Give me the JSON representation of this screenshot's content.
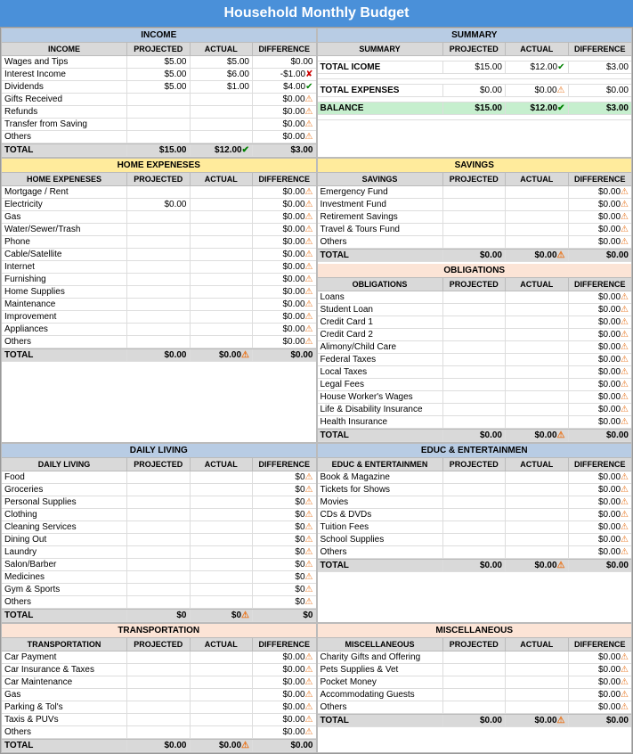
{
  "title": "Household Monthly Budget",
  "income": {
    "header": "INCOME",
    "cols": [
      "INCOME",
      "PROJECTED",
      "ACTUAL",
      "DIFFERENCE"
    ],
    "rows": [
      {
        "label": "Wages and Tips",
        "projected": "$5.00",
        "actual": "$5.00",
        "diff": "$0.00",
        "icon": ""
      },
      {
        "label": "Interest Income",
        "projected": "$5.00",
        "actual": "$6.00",
        "diff": "-$1.00",
        "icon": "red"
      },
      {
        "label": "Dividends",
        "projected": "$5.00",
        "actual": "$1.00",
        "diff": "$4.00",
        "icon": "green"
      },
      {
        "label": "Gifts Received",
        "projected": "",
        "actual": "",
        "diff": "$0.00",
        "icon": "orange"
      },
      {
        "label": "Refunds",
        "projected": "",
        "actual": "",
        "diff": "$0.00",
        "icon": "orange"
      },
      {
        "label": "Transfer from Saving",
        "projected": "",
        "actual": "",
        "diff": "$0.00",
        "icon": "orange"
      },
      {
        "label": "Others",
        "projected": "",
        "actual": "",
        "diff": "$0.00",
        "icon": "orange"
      }
    ],
    "total": {
      "label": "TOTAL",
      "projected": "$15.00",
      "actual": "$12.00",
      "diff": "$3.00",
      "icon": "green"
    }
  },
  "summary": {
    "header": "SUMMARY",
    "rows": [
      {
        "label": "TOTAL ICOME",
        "projected": "$15.00",
        "actual": "$12.00",
        "diff": "$3.00",
        "icon": "green"
      },
      {
        "label": "TOTAL EXPENSES",
        "projected": "$0.00",
        "actual": "$0.00",
        "diff": "$0.00",
        "icon": "orange"
      },
      {
        "label": "BALANCE",
        "projected": "$15.00",
        "actual": "$12.00",
        "diff": "$3.00",
        "icon": "green"
      }
    ]
  },
  "home_expenses": {
    "header": "HOME EXPENESES",
    "rows": [
      {
        "label": "Mortgage / Rent",
        "projected": "",
        "actual": "",
        "diff": "$0.00",
        "icon": "orange"
      },
      {
        "label": "Electricity",
        "projected": "$0.00",
        "actual": "",
        "diff": "$0.00",
        "icon": "orange"
      },
      {
        "label": "Gas",
        "projected": "",
        "actual": "",
        "diff": "$0.00",
        "icon": "orange"
      },
      {
        "label": "Water/Sewer/Trash",
        "projected": "",
        "actual": "",
        "diff": "$0.00",
        "icon": "orange"
      },
      {
        "label": "Phone",
        "projected": "",
        "actual": "",
        "diff": "$0.00",
        "icon": "orange"
      },
      {
        "label": "Cable/Satellite",
        "projected": "",
        "actual": "",
        "diff": "$0.00",
        "icon": "orange"
      },
      {
        "label": "Internet",
        "projected": "",
        "actual": "",
        "diff": "$0.00",
        "icon": "orange"
      },
      {
        "label": "Furnishing",
        "projected": "",
        "actual": "",
        "diff": "$0.00",
        "icon": "orange"
      },
      {
        "label": "Home Supplies",
        "projected": "",
        "actual": "",
        "diff": "$0.00",
        "icon": "orange"
      },
      {
        "label": "Maintenance",
        "projected": "",
        "actual": "",
        "diff": "$0.00",
        "icon": "orange"
      },
      {
        "label": "Improvement",
        "projected": "",
        "actual": "",
        "diff": "$0.00",
        "icon": "orange"
      },
      {
        "label": "Appliances",
        "projected": "",
        "actual": "",
        "diff": "$0.00",
        "icon": "orange"
      },
      {
        "label": "Others",
        "projected": "",
        "actual": "",
        "diff": "$0.00",
        "icon": "orange"
      }
    ],
    "total": {
      "label": "TOTAL",
      "projected": "$0.00",
      "actual": "$0.00",
      "diff": "$0.00",
      "icon": "orange"
    }
  },
  "savings": {
    "header": "SAVINGS",
    "rows": [
      {
        "label": "Emergency Fund",
        "projected": "",
        "actual": "",
        "diff": "$0.00",
        "icon": "orange"
      },
      {
        "label": "Investment Fund",
        "projected": "",
        "actual": "",
        "diff": "$0.00",
        "icon": "orange"
      },
      {
        "label": "Retirement Savings",
        "projected": "",
        "actual": "",
        "diff": "$0.00",
        "icon": "orange"
      },
      {
        "label": "Travel & Tours Fund",
        "projected": "",
        "actual": "",
        "diff": "$0.00",
        "icon": "orange"
      },
      {
        "label": "Others",
        "projected": "",
        "actual": "",
        "diff": "$0.00",
        "icon": "orange"
      }
    ],
    "total": {
      "label": "TOTAL",
      "projected": "$0.00",
      "actual": "$0.00",
      "diff": "$0.00",
      "icon": "orange"
    }
  },
  "obligations": {
    "header": "OBLIGATIONS",
    "rows": [
      {
        "label": "Loans",
        "projected": "",
        "actual": "",
        "diff": "$0.00",
        "icon": "orange"
      },
      {
        "label": "Student Loan",
        "projected": "",
        "actual": "",
        "diff": "$0.00",
        "icon": "orange"
      },
      {
        "label": "Credit Card 1",
        "projected": "",
        "actual": "",
        "diff": "$0.00",
        "icon": "orange"
      },
      {
        "label": "Credit Card 2",
        "projected": "",
        "actual": "",
        "diff": "$0.00",
        "icon": "orange"
      },
      {
        "label": "Alimony/Child Care",
        "projected": "",
        "actual": "",
        "diff": "$0.00",
        "icon": "orange"
      },
      {
        "label": "Federal Taxes",
        "projected": "",
        "actual": "",
        "diff": "$0.00",
        "icon": "orange"
      },
      {
        "label": "Local Taxes",
        "projected": "",
        "actual": "",
        "diff": "$0.00",
        "icon": "orange"
      },
      {
        "label": "Legal Fees",
        "projected": "",
        "actual": "",
        "diff": "$0.00",
        "icon": "orange"
      },
      {
        "label": "House Worker's Wages",
        "projected": "",
        "actual": "",
        "diff": "$0.00",
        "icon": "orange"
      },
      {
        "label": "Life & Disability Insurance",
        "projected": "",
        "actual": "",
        "diff": "$0.00",
        "icon": "orange"
      },
      {
        "label": "Health Insurance",
        "projected": "",
        "actual": "",
        "diff": "$0.00",
        "icon": "orange"
      }
    ],
    "total": {
      "label": "TOTAL",
      "projected": "$0.00",
      "actual": "$0.00",
      "diff": "$0.00",
      "icon": "orange"
    }
  },
  "daily_living": {
    "header": "DAILY LIVING",
    "rows": [
      {
        "label": "Food",
        "projected": "",
        "actual": "",
        "diff": "$0",
        "icon": "orange"
      },
      {
        "label": "Groceries",
        "projected": "",
        "actual": "",
        "diff": "$0",
        "icon": "orange"
      },
      {
        "label": "Personal Supplies",
        "projected": "",
        "actual": "",
        "diff": "$0",
        "icon": "orange"
      },
      {
        "label": "Clothing",
        "projected": "",
        "actual": "",
        "diff": "$0",
        "icon": "orange"
      },
      {
        "label": "Cleaning Services",
        "projected": "",
        "actual": "",
        "diff": "$0",
        "icon": "orange"
      },
      {
        "label": "Dining Out",
        "projected": "",
        "actual": "",
        "diff": "$0",
        "icon": "orange"
      },
      {
        "label": "Laundry",
        "projected": "",
        "actual": "",
        "diff": "$0",
        "icon": "orange"
      },
      {
        "label": "Salon/Barber",
        "projected": "",
        "actual": "",
        "diff": "$0",
        "icon": "orange"
      },
      {
        "label": "Medicines",
        "projected": "",
        "actual": "",
        "diff": "$0",
        "icon": "orange"
      },
      {
        "label": "Gym & Sports",
        "projected": "",
        "actual": "",
        "diff": "$0",
        "icon": "orange"
      },
      {
        "label": "Others",
        "projected": "",
        "actual": "",
        "diff": "$0",
        "icon": "orange"
      }
    ],
    "total": {
      "label": "TOTAL",
      "projected": "$0",
      "actual": "$0",
      "diff": "$0",
      "icon": "orange"
    }
  },
  "educ_entertainment": {
    "header": "EDUC & ENTERTAINMEN",
    "rows": [
      {
        "label": "Book & Magazine",
        "projected": "",
        "actual": "",
        "diff": "$0.00",
        "icon": "orange"
      },
      {
        "label": "Tickets for Shows",
        "projected": "",
        "actual": "",
        "diff": "$0.00",
        "icon": "orange"
      },
      {
        "label": "Movies",
        "projected": "",
        "actual": "",
        "diff": "$0.00",
        "icon": "orange"
      },
      {
        "label": "CDs & DVDs",
        "projected": "",
        "actual": "",
        "diff": "$0.00",
        "icon": "orange"
      },
      {
        "label": "Tuition Fees",
        "projected": "",
        "actual": "",
        "diff": "$0.00",
        "icon": "orange"
      },
      {
        "label": "School Supplies",
        "projected": "",
        "actual": "",
        "diff": "$0.00",
        "icon": "orange"
      },
      {
        "label": "Others",
        "projected": "",
        "actual": "",
        "diff": "$0.00",
        "icon": "orange"
      }
    ],
    "total": {
      "label": "TOTAL",
      "projected": "$0.00",
      "actual": "$0.00",
      "diff": "$0.00",
      "icon": "orange"
    }
  },
  "transportation": {
    "header": "TRANSPORTATION",
    "rows": [
      {
        "label": "Car Payment",
        "projected": "",
        "actual": "",
        "diff": "$0.00",
        "icon": "orange"
      },
      {
        "label": "Car Insurance & Taxes",
        "projected": "",
        "actual": "",
        "diff": "$0.00",
        "icon": "orange"
      },
      {
        "label": "Car Maintenance",
        "projected": "",
        "actual": "",
        "diff": "$0.00",
        "icon": "orange"
      },
      {
        "label": "Gas",
        "projected": "",
        "actual": "",
        "diff": "$0.00",
        "icon": "orange"
      },
      {
        "label": "Parking & Tol's",
        "projected": "",
        "actual": "",
        "diff": "$0.00",
        "icon": "orange"
      },
      {
        "label": "Taxis & PUVs",
        "projected": "",
        "actual": "",
        "diff": "$0.00",
        "icon": "orange"
      },
      {
        "label": "Others",
        "projected": "",
        "actual": "",
        "diff": "$0.00",
        "icon": "orange"
      }
    ],
    "total": {
      "label": "TOTAL",
      "projected": "$0.00",
      "actual": "$0.00",
      "diff": "$0.00",
      "icon": "orange"
    }
  },
  "miscellaneous": {
    "header": "MISCELLANEOUS",
    "rows": [
      {
        "label": "Charity Gifts and Offering",
        "projected": "",
        "actual": "",
        "diff": "$0.00",
        "icon": "orange"
      },
      {
        "label": "Pets Supplies & Vet",
        "projected": "",
        "actual": "",
        "diff": "$0.00",
        "icon": "orange"
      },
      {
        "label": "Pocket Money",
        "projected": "",
        "actual": "",
        "diff": "$0.00",
        "icon": "orange"
      },
      {
        "label": "Accommodating Guests",
        "projected": "",
        "actual": "",
        "diff": "$0.00",
        "icon": "orange"
      },
      {
        "label": "Others",
        "projected": "",
        "actual": "",
        "diff": "$0.00",
        "icon": "orange"
      }
    ],
    "total": {
      "label": "TOTAL",
      "projected": "$0.00",
      "actual": "$0.00",
      "diff": "$0.00",
      "icon": "orange"
    }
  },
  "icons": {
    "orange": "⚠",
    "green": "✔",
    "red": "✘"
  }
}
